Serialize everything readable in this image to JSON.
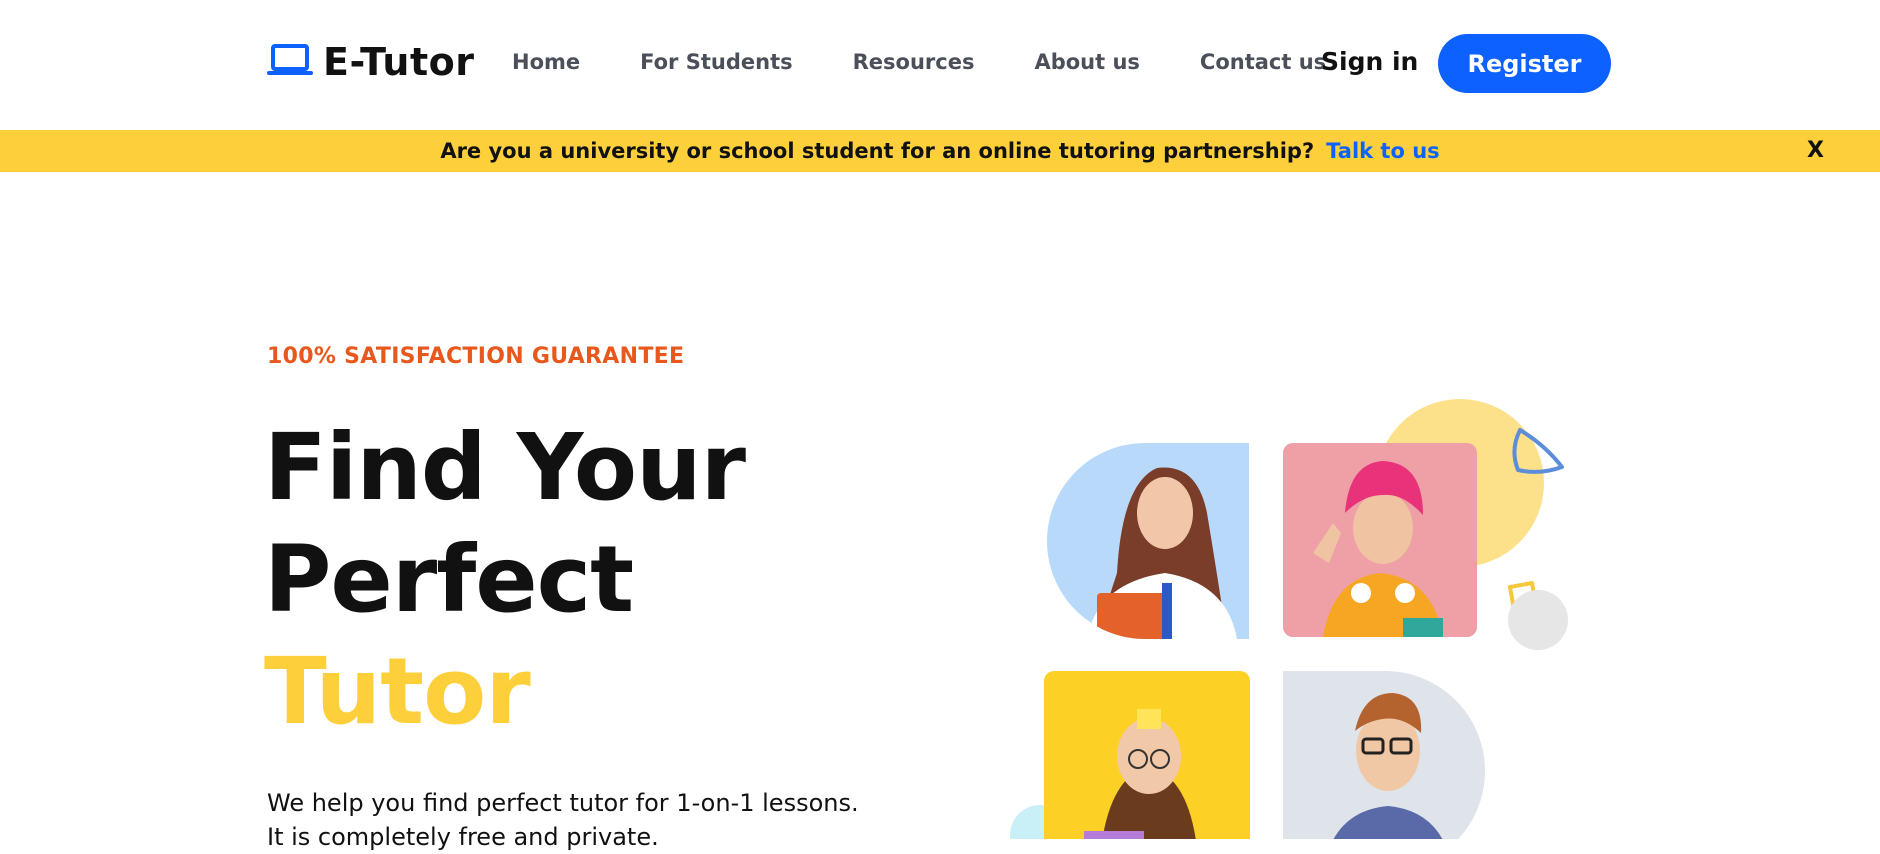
{
  "brand": {
    "name": "E-Tutor",
    "icon": "laptop-icon",
    "accent": "#0d62ff"
  },
  "nav": {
    "links": [
      "Home",
      "For Students",
      "Resources",
      "About us",
      "Contact us"
    ],
    "signin_label": "Sign in",
    "register_label": "Register"
  },
  "banner": {
    "text": "Are you a university or school student for an online tutoring partnership?",
    "link_text": "Talk to us",
    "close_label": "X",
    "background": "#fdd03b"
  },
  "hero": {
    "eyebrow": "100% SATISFACTION GUARANTEE",
    "title_line1": "Find Your",
    "title_line2": "Perfect",
    "title_line3": "Tutor",
    "subtext_line1": "We help you find perfect tutor for 1-on-1 lessons.",
    "subtext_line2": "It is completely free and private."
  },
  "colors": {
    "eyebrow": "#e8581c",
    "highlight": "#fdd03b",
    "primary": "#0d62ff"
  }
}
